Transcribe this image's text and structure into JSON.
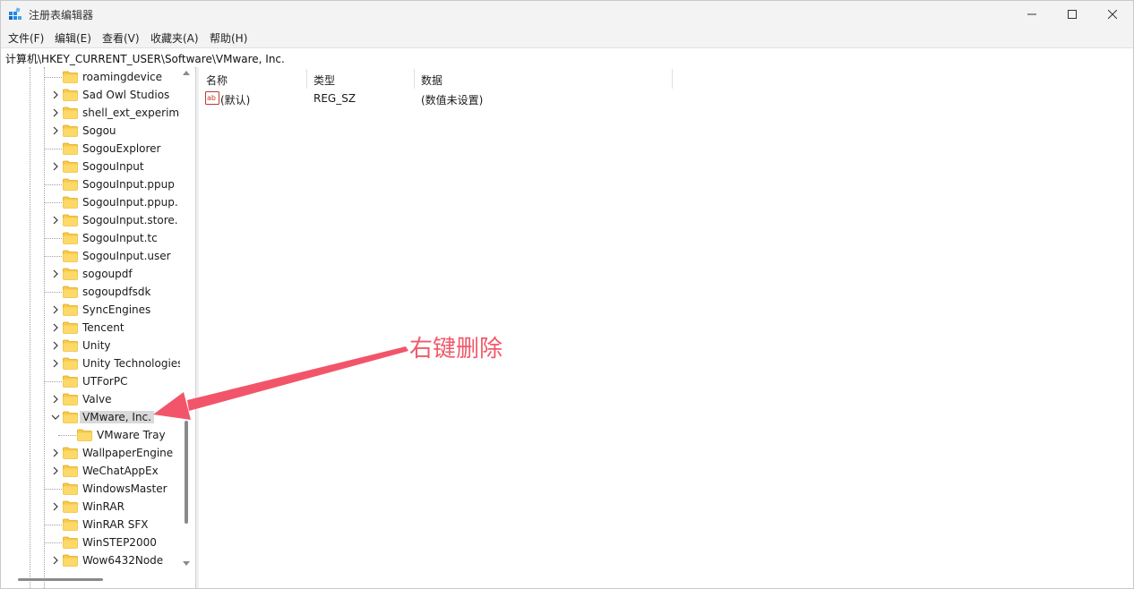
{
  "window": {
    "title": "注册表编辑器",
    "controls": [
      "minimize-icon",
      "maximize-icon",
      "close-icon"
    ]
  },
  "menu": [
    "文件(F)",
    "编辑(E)",
    "查看(V)",
    "收藏夹(A)",
    "帮助(H)"
  ],
  "address": "计算机\\HKEY_CURRENT_USER\\Software\\VMware, Inc.",
  "tree": {
    "items": [
      {
        "label": "roamingdevice",
        "expandable": false,
        "level": 1
      },
      {
        "label": "Sad Owl Studios",
        "expandable": true,
        "level": 1
      },
      {
        "label": "shell_ext_experime",
        "expandable": true,
        "level": 1
      },
      {
        "label": "Sogou",
        "expandable": true,
        "level": 1
      },
      {
        "label": "SogouExplorer",
        "expandable": false,
        "level": 1
      },
      {
        "label": "SogouInput",
        "expandable": true,
        "level": 1
      },
      {
        "label": "SogouInput.ppup",
        "expandable": false,
        "level": 1
      },
      {
        "label": "SogouInput.ppup.",
        "expandable": false,
        "level": 1
      },
      {
        "label": "SogouInput.store.",
        "expandable": true,
        "level": 1
      },
      {
        "label": "SogouInput.tc",
        "expandable": false,
        "level": 1
      },
      {
        "label": "SogouInput.user",
        "expandable": false,
        "level": 1
      },
      {
        "label": "sogoupdf",
        "expandable": true,
        "level": 1
      },
      {
        "label": "sogoupdfsdk",
        "expandable": false,
        "level": 1
      },
      {
        "label": "SyncEngines",
        "expandable": true,
        "level": 1
      },
      {
        "label": "Tencent",
        "expandable": true,
        "level": 1
      },
      {
        "label": "Unity",
        "expandable": true,
        "level": 1
      },
      {
        "label": "Unity Technologies",
        "expandable": true,
        "level": 1
      },
      {
        "label": "UTForPC",
        "expandable": false,
        "level": 1
      },
      {
        "label": "Valve",
        "expandable": true,
        "level": 1
      },
      {
        "label": "VMware, Inc.",
        "expandable": true,
        "expanded": true,
        "selected": true,
        "level": 1
      },
      {
        "label": "VMware Tray",
        "expandable": false,
        "level": 2
      },
      {
        "label": "WallpaperEngine",
        "expandable": true,
        "level": 1
      },
      {
        "label": "WeChatAppEx",
        "expandable": true,
        "level": 1
      },
      {
        "label": "WindowsMaster",
        "expandable": false,
        "level": 1
      },
      {
        "label": "WinRAR",
        "expandable": true,
        "level": 1
      },
      {
        "label": "WinRAR SFX",
        "expandable": false,
        "level": 1
      },
      {
        "label": "WinSTEP2000",
        "expandable": false,
        "level": 1
      },
      {
        "label": "Wow6432Node",
        "expandable": true,
        "level": 1
      }
    ]
  },
  "list": {
    "columns": [
      "名称",
      "类型",
      "数据"
    ],
    "rows": [
      {
        "name": "(默认)",
        "type": "REG_SZ",
        "data": "(数值未设置)",
        "icon": "string-value-icon"
      }
    ]
  },
  "annotation": {
    "text": "右键删除",
    "color": "#f05a6b"
  }
}
